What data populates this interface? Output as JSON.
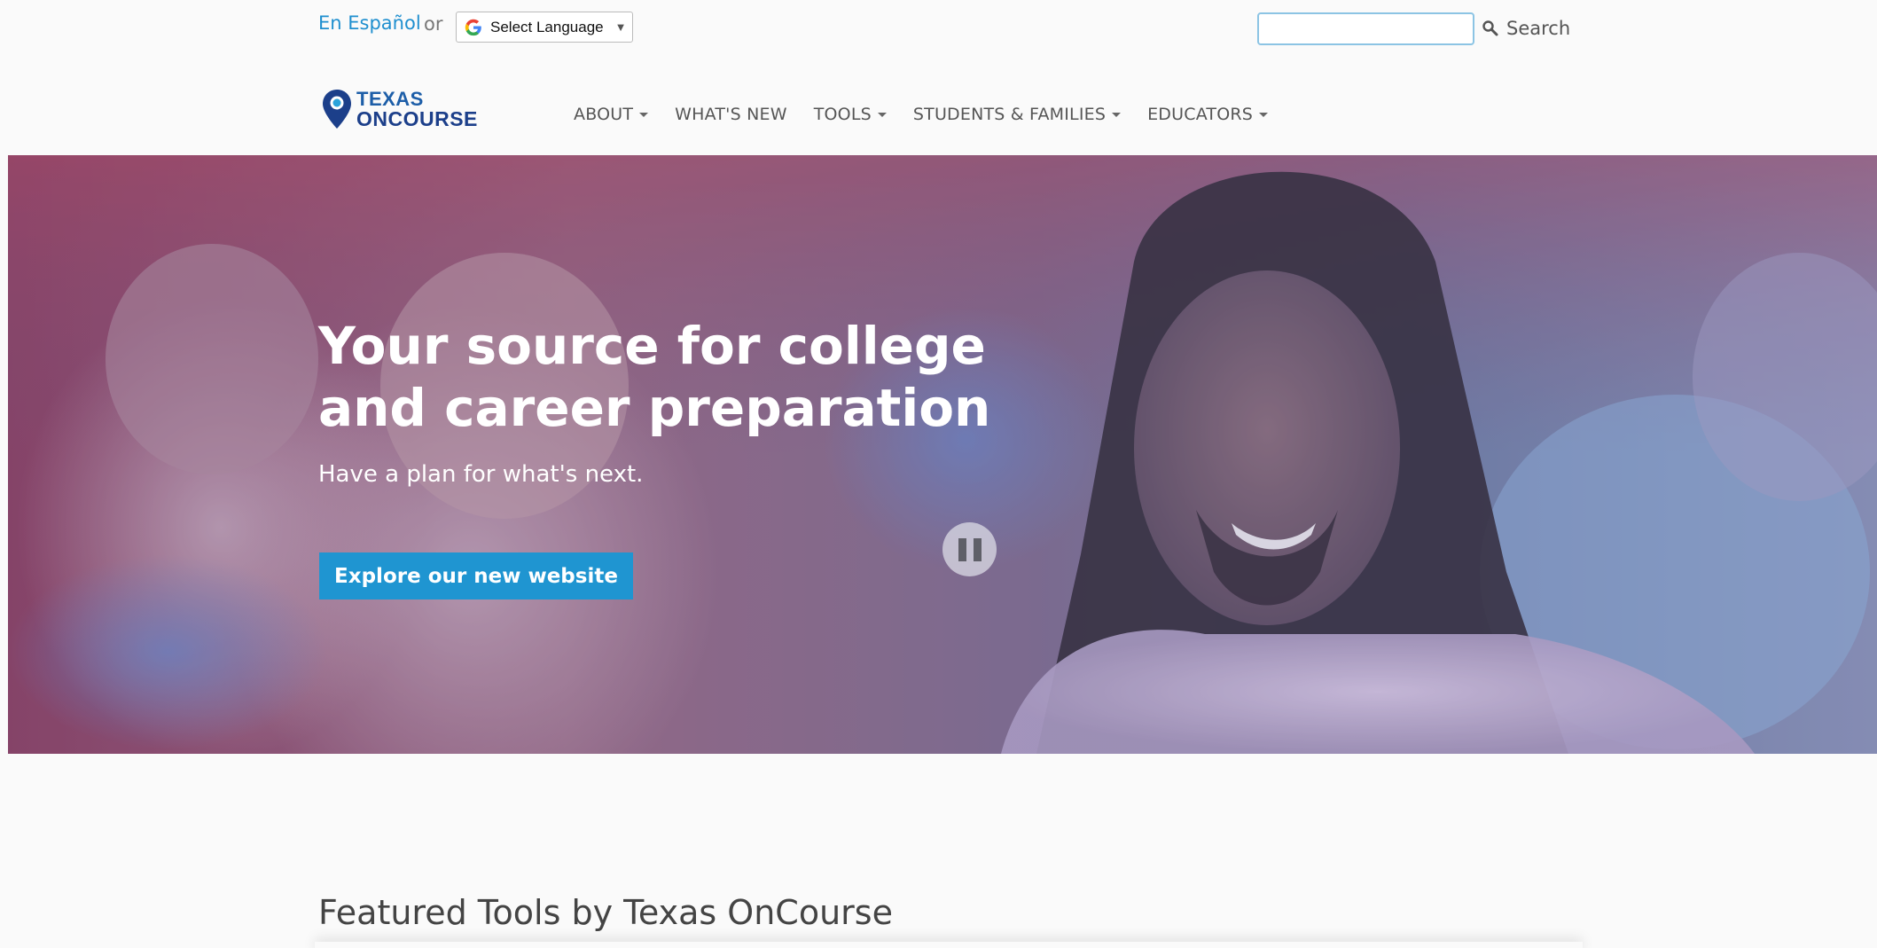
{
  "topbar": {
    "espanol_link": "En Español",
    "or_text": "or",
    "language_select": "Select Language",
    "language_arrow": "▼",
    "search_placeholder": "",
    "search_label": "Search"
  },
  "logo": {
    "line1": "TEXAS",
    "line2": "ONCOURSE"
  },
  "nav": {
    "items": [
      {
        "label": "ABOUT",
        "dropdown": true
      },
      {
        "label": "WHAT'S NEW",
        "dropdown": false
      },
      {
        "label": "TOOLS",
        "dropdown": true
      },
      {
        "label": "STUDENTS & FAMILIES",
        "dropdown": true
      },
      {
        "label": "EDUCATORS",
        "dropdown": true
      }
    ]
  },
  "hero": {
    "title": "Your source for college and career preparation",
    "subtitle": "Have a plan for what's next.",
    "cta_label": "Explore our new website"
  },
  "featured": {
    "title": "Featured Tools by Texas OnCourse"
  },
  "colors": {
    "link": "#1f8fcf",
    "cta": "#1f95d1",
    "logo_blue": "#1c3f8a"
  }
}
